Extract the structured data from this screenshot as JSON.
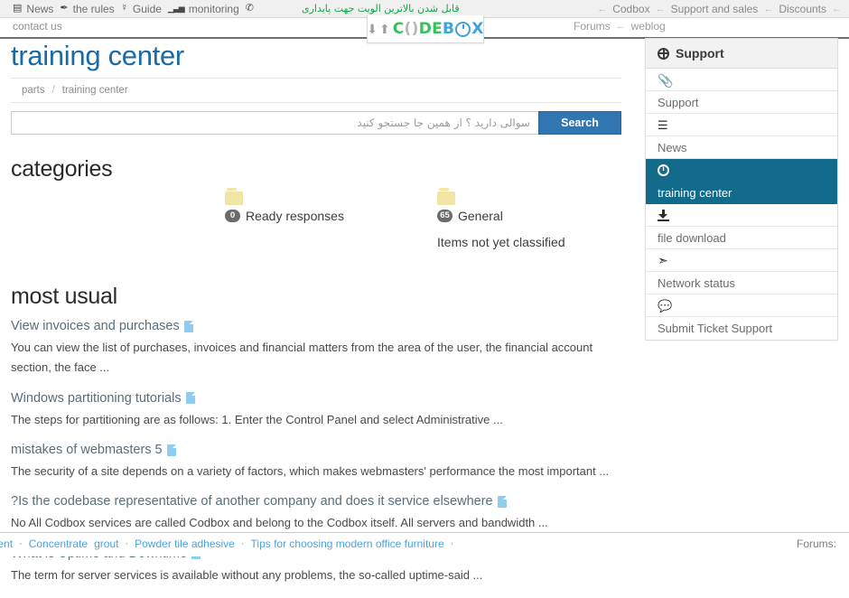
{
  "topbar": {
    "left_items": [
      {
        "icon": "newspaper-icon",
        "glyph": "▤",
        "label": "News"
      },
      {
        "icon": "gavel-icon",
        "glyph": "✎",
        "label": "the rules"
      },
      {
        "icon": "lightbulb-icon",
        "glyph": "♀",
        "label": "Guide"
      },
      {
        "icon": "signal-bars-icon",
        "glyph": "▁▃▅",
        "label": "monitoring"
      },
      {
        "icon": "phone-icon",
        "glyph": "✆",
        "label": ""
      }
    ],
    "persian_notice": "قابل شدن بالاترین الویت جهت پایداری",
    "right_items": [
      {
        "label": "Codbox"
      },
      {
        "label": "Support and sales"
      },
      {
        "label": "Discounts"
      }
    ],
    "arrow_glyph": "←"
  },
  "secondbar": {
    "contact_label": "contact us",
    "forums_label": "Forums",
    "weblog_label": "weblog",
    "arrow_glyph": "←"
  },
  "logo": {
    "down_arrow": "⬇",
    "up_arrow": "⬆",
    "part_1": "C",
    "part_2": "()",
    "part_3": "DE",
    "part_4": "B",
    "part_5": "X",
    "green": "#35c15e",
    "blue": "#3da3dd"
  },
  "page": {
    "title": "training center",
    "title_color": "#1b6aa5"
  },
  "breadcrumb": {
    "items": [
      "parts",
      "training center"
    ],
    "separator": "/"
  },
  "search": {
    "placeholder": "سوالی دارید ؟ از همین جا جستجو کنید",
    "value": "",
    "button_label": "Search",
    "button_color": "#3276b1"
  },
  "categories": {
    "heading": "categories",
    "items": [
      {
        "count": "0",
        "name": "Ready responses",
        "description": ""
      },
      {
        "count": "65",
        "name": "General",
        "description": "Items not yet classified"
      }
    ]
  },
  "most_usual": {
    "heading": "most usual",
    "articles": [
      {
        "title": "View invoices and purchases",
        "description": "You can view the list of purchases, invoices and financial matters from the area of the user, the financial account section, the face ..."
      },
      {
        "title": "Windows partitioning tutorials",
        "description": "The steps for partitioning are as follows: 1. Enter the Control Panel and select Administrative ..."
      },
      {
        "title": "mistakes of webmasters 5",
        "description": "The security of a site depends on a variety of factors, which makes webmasters' performance the most important ..."
      },
      {
        "title": "?Is the codebase representative of another company and does it service elsewhere",
        "description": "No All Codbox services are called Codbox and belong to the Codbox itself. All servers and bandwidth ..."
      },
      {
        "title": "What is Uptime and Downtime",
        "description": "The term for server services is available without any problems, the so-called uptime-said ..."
      }
    ]
  },
  "sidebar": {
    "header": "Support",
    "header_icon": "lifebuoy-icon",
    "active_color": "#126b8a",
    "items": [
      {
        "icon": "paperclip-icon",
        "label": "Support",
        "active": false
      },
      {
        "icon": "list-icon",
        "label": "News",
        "active": false
      },
      {
        "icon": "info-circle-icon",
        "label": "training center",
        "active": true
      },
      {
        "icon": "download-icon",
        "label": "file download",
        "active": false
      },
      {
        "icon": "rocket-icon",
        "label": "Network status",
        "active": false
      },
      {
        "icon": "comments-icon",
        "label": "Submit Ticket Support",
        "active": false
      }
    ]
  },
  "footer": {
    "links": [
      "g agent",
      "Concentrate",
      "grout",
      "Powder tile adhesive",
      "Tips for choosing modern office furniture"
    ],
    "separator": "·",
    "right_label": "Forums:",
    "link_color": "#4aa3df"
  }
}
